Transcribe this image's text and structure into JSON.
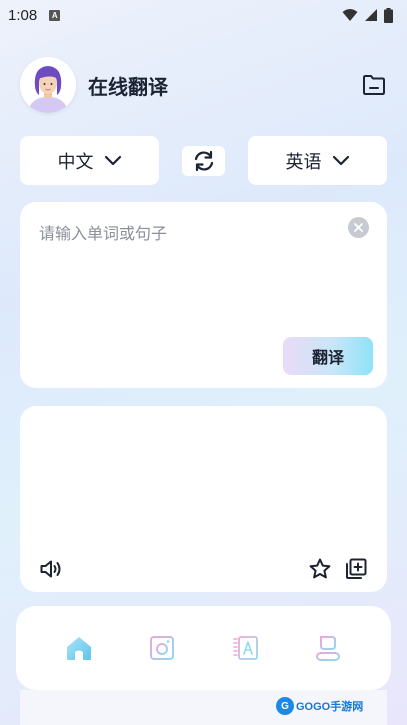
{
  "status_bar": {
    "time": "1:08",
    "a_badge": "A"
  },
  "header": {
    "title": "在线翻译"
  },
  "language": {
    "source": "中文",
    "target": "英语"
  },
  "input": {
    "placeholder": "请输入单词或句子",
    "translate_label": "翻译"
  },
  "watermark": {
    "badge": "G",
    "text": "GOGO手游网"
  },
  "colors": {
    "accent_gradient_start": "#eadbf7",
    "accent_gradient_end": "#8fe2f8",
    "nav_home_active": "#7fd3ee",
    "nav_icon_inactive": "#9fdff2",
    "text_primary": "#1c2333",
    "placeholder": "#8a8f99"
  },
  "icons": {
    "folder": "folder-icon",
    "swap": "swap-icon",
    "clear": "clear-icon",
    "speaker": "speaker-icon",
    "favorite": "star-icon",
    "copy": "copy-add-icon",
    "nav_home": "home-icon",
    "nav_camera": "camera-icon",
    "nav_dictionary": "dictionary-icon",
    "nav_profile": "profile-icon"
  }
}
